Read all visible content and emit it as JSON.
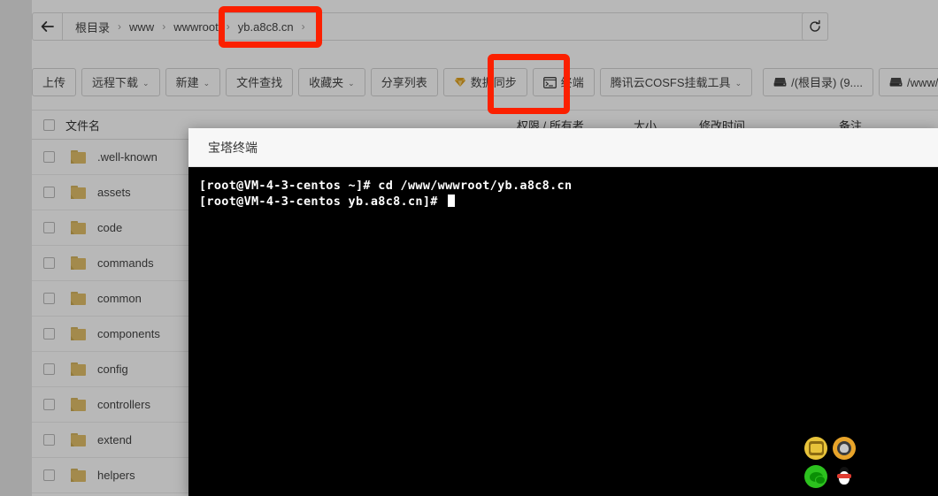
{
  "breadcrumb": {
    "back_icon": "arrow-left-icon",
    "items": [
      {
        "label": "根目录"
      },
      {
        "label": "www"
      },
      {
        "label": "wwwroot"
      },
      {
        "label": "yb.a8c8.cn"
      }
    ],
    "separator": "›",
    "trailing_separator": "›"
  },
  "refresh": {
    "icon": "refresh-icon",
    "title": "刷新"
  },
  "toolbar": {
    "buttons": [
      {
        "label": "上传",
        "caret": "",
        "icon": ""
      },
      {
        "label": "远程下载",
        "caret": "⌄",
        "icon": ""
      },
      {
        "label": "新建",
        "caret": "⌄",
        "icon": ""
      },
      {
        "label": "文件查找",
        "caret": "",
        "icon": ""
      },
      {
        "label": "收藏夹",
        "caret": "⌄",
        "icon": ""
      },
      {
        "label": "分享列表",
        "caret": "",
        "icon": ""
      },
      {
        "label": "数据同步",
        "caret": "",
        "icon": "gem-icon"
      },
      {
        "label": "终端",
        "caret": "",
        "icon": "terminal-icon"
      },
      {
        "label": "腾讯云COSFS挂载工具",
        "caret": "⌄",
        "icon": ""
      }
    ],
    "disks": [
      {
        "label": "/(根目录) (9....",
        "icon": "disk-icon"
      },
      {
        "label": "/www/cosfs/…",
        "icon": "disk-icon"
      }
    ]
  },
  "table": {
    "headers": {
      "name": "文件名",
      "perm": "权限 / 所有者",
      "size": "大小",
      "mtime": "修改时间",
      "note": "备注"
    },
    "rows": [
      {
        "name": ".well-known",
        "icon": "folder-icon"
      },
      {
        "name": "assets",
        "icon": "folder-icon"
      },
      {
        "name": "code",
        "icon": "folder-icon"
      },
      {
        "name": "commands",
        "icon": "folder-icon"
      },
      {
        "name": "common",
        "icon": "folder-icon"
      },
      {
        "name": "components",
        "icon": "folder-icon"
      },
      {
        "name": "config",
        "icon": "folder-icon"
      },
      {
        "name": "controllers",
        "icon": "folder-icon"
      },
      {
        "name": "extend",
        "icon": "folder-icon"
      },
      {
        "name": "helpers",
        "icon": "folder-icon"
      }
    ]
  },
  "terminal": {
    "title": "宝塔终端",
    "lines": [
      "[root@VM-4-3-centos ~]# cd /www/wwwroot/yb.a8c8.cn",
      "[root@VM-4-3-centos yb.a8c8.cn]# "
    ]
  },
  "contacts": [
    {
      "name": "badge-icon"
    },
    {
      "name": "person-icon"
    },
    {
      "name": "wechat-icon"
    },
    {
      "name": "qq-penguin-icon"
    }
  ],
  "colors": {
    "annotation_red": "#fb2000",
    "folder_yellow": "#e2c06a",
    "terminal_bg": "#000000",
    "terminal_text": "#ffffff"
  }
}
